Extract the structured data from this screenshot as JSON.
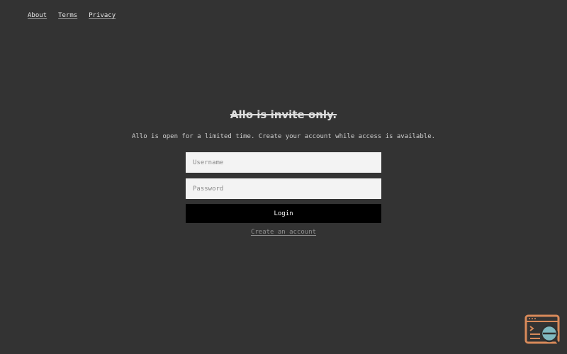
{
  "nav": {
    "items": [
      "About",
      "Terms",
      "Privacy"
    ]
  },
  "main": {
    "headline": "Allo is invite only.",
    "subline": "Allo is open for a limited time. Create your account while access is available.",
    "username_placeholder": "Username",
    "password_placeholder": "Password",
    "login_label": "Login",
    "create_account_label": "Create an account"
  },
  "badge": {
    "icon": "browser-window-search-icon"
  },
  "colors": {
    "background": "#333333",
    "input_background": "#f3f3f3",
    "button_background": "#000000",
    "badge_accent": "#d88a5a",
    "badge_teal": "#7fb8c0"
  }
}
